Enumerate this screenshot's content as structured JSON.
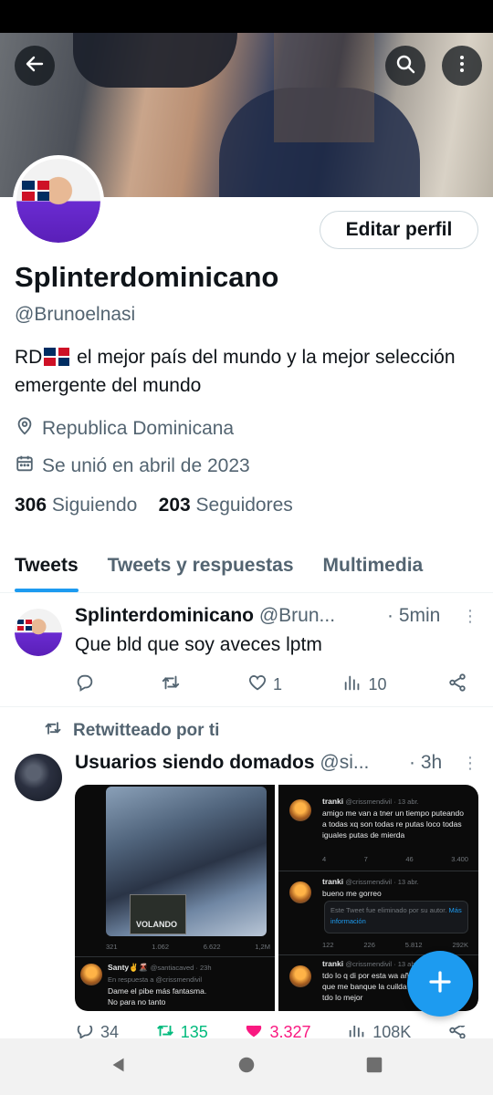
{
  "banner": {
    "back_icon": "arrow-left-icon",
    "search_icon": "search-icon",
    "more_icon": "more-vertical-icon"
  },
  "profile": {
    "edit_label": "Editar perfil",
    "display_name": "Splinterdominicano",
    "handle": "@Brunoelnasi",
    "bio_prefix": "RD",
    "bio_suffix": " el mejor país del mundo y la mejor selección emergente del mundo",
    "location": "Republica Dominicana",
    "joined": "Se unió en abril de 2023",
    "following_count": "306",
    "following_label": "Siguiendo",
    "followers_count": "203",
    "followers_label": "Seguidores"
  },
  "tabs": [
    {
      "label": "Tweets",
      "active": true
    },
    {
      "label": "Tweets y respuestas",
      "active": false
    },
    {
      "label": "Multimedia",
      "active": false
    }
  ],
  "tweets": [
    {
      "name": "Splinterdominicano",
      "handle": "@Brun...",
      "time": "· 5min",
      "text": "Que bld que soy aveces lptm",
      "actions": {
        "reply": "",
        "retweet": "",
        "like": "1",
        "views": "10"
      }
    },
    {
      "retweeted_label": "Retwitteado por ti",
      "name": "Usuarios siendo domados",
      "handle": "@si...",
      "time": "· 3h",
      "media": {
        "left": {
          "stats": [
            "321",
            "1.062",
            "6.622",
            "1,2M"
          ],
          "reply_name": "Santy✌️🌋",
          "reply_handle": "@santiacaved · 23h",
          "reply_to": "En respuesta a @crissmendivil",
          "reply_text_1": "Dame el pibe más fantasma.",
          "reply_text_2": "No para no tanto",
          "poster_text": "VOLANDO"
        },
        "right": {
          "name": "tranki",
          "handle_1": "@crissmendivil · 13 abr.",
          "text_1": "amigo me van a tner un tiempo puteando a todas xq son todas re putas loco todas iguales putas de mierda",
          "stats_1": [
            "4",
            "7",
            "46",
            "3.400"
          ],
          "handle_2": "@crissmendivil · 13 abr.",
          "text_2": "bueno me gorreo",
          "deleted_text": "Este Tweet fue eliminado por su autor.",
          "deleted_link": "Más información",
          "stats_2": [
            "122",
            "226",
            "5.812",
            "292K"
          ],
          "handle_3": "@crissmendivil · 13 abr.",
          "text_3": "tdo lo q di por esta wa años tdo lo q tuve que me banque la cuilda a p espere lo di tdo lo mejor"
        }
      },
      "actions": {
        "reply": "34",
        "retweet": "135",
        "like": "3.327",
        "views": "108K"
      }
    }
  ],
  "fab_icon": "plus-icon",
  "colors": {
    "accent": "#1d9bf0",
    "secondary_text": "#536471",
    "retweet_green": "#00ba7c",
    "like_pink": "#f91880"
  },
  "nav": {
    "back": "back-triangle-icon",
    "home": "home-circle-icon",
    "recents": "recents-square-icon"
  }
}
